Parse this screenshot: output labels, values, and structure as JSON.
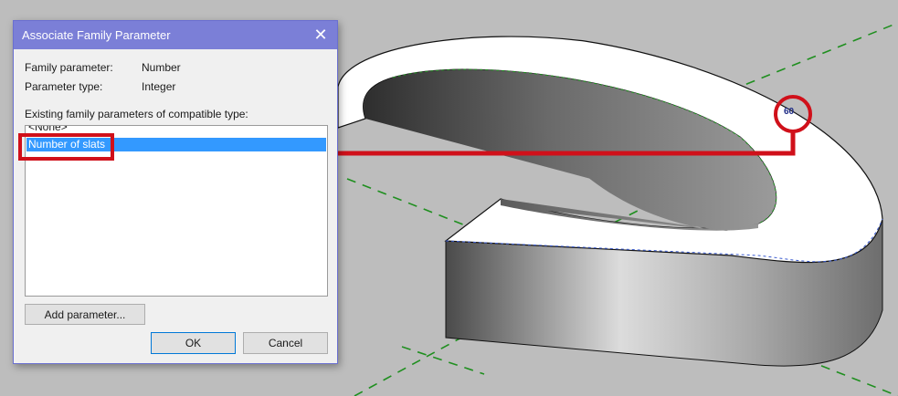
{
  "dialog": {
    "title": "Associate Family Parameter",
    "family_parameter_label": "Family parameter:",
    "family_parameter_value": "Number",
    "parameter_type_label": "Parameter type:",
    "parameter_type_value": "Integer",
    "existing_params_label": "Existing family parameters of compatible type:",
    "list_items": [
      {
        "label": "<None>",
        "selected": false
      },
      {
        "label": "Number of slats",
        "selected": true
      }
    ],
    "add_parameter_label": "Add parameter...",
    "ok_label": "OK",
    "cancel_label": "Cancel"
  },
  "viewport": {
    "dimension_value": "60",
    "background_color": "#bdbdbd",
    "highlight_color": "#d0101a",
    "selection_color": "#3399ff",
    "reference_line_color": "#1f8f1f"
  }
}
